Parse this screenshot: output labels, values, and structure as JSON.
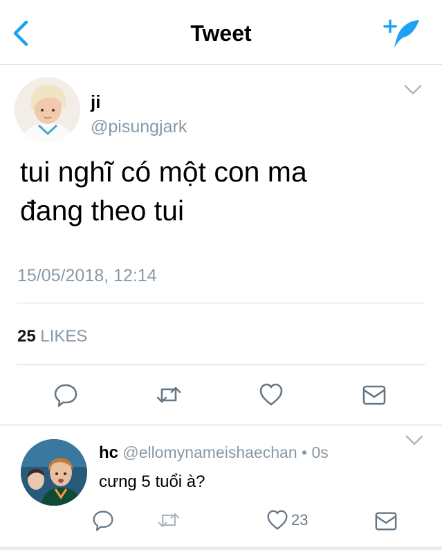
{
  "header": {
    "title": "Tweet",
    "back_icon": "chevron-left-icon",
    "compose_icon": "compose-tweet-icon",
    "accent": "#1da1f2"
  },
  "tweet": {
    "name": "ji",
    "handle": "@pisungjark",
    "text_line1": "tui nghĩ có một con ma",
    "text_line2": "đang theo tui",
    "timestamp": "15/05/2018, 12:14",
    "likes_count": "25",
    "likes_label": "LIKES"
  },
  "reply": {
    "name": "hc",
    "handle_time": "@ellomynameishaechan • 0s",
    "text": "cưng 5 tuổi à?",
    "like_count": "23"
  }
}
